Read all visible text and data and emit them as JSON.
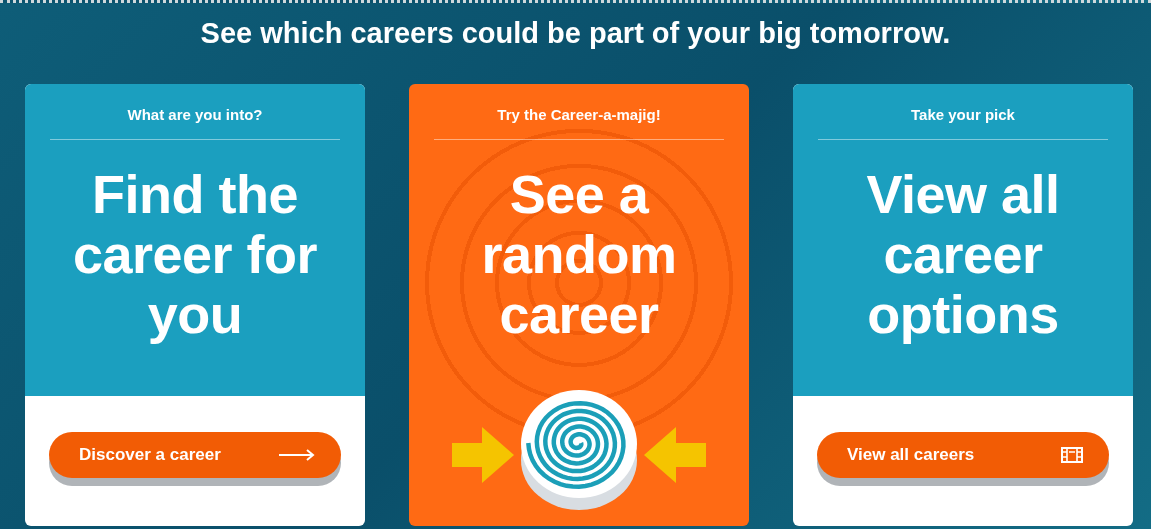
{
  "heading": "See which careers could be part of your big tomorrow.",
  "cards": [
    {
      "kind": "link",
      "eyebrow": "What are you into?",
      "headline": "Find the\ncareer for\nyou",
      "button": {
        "label": "Discover a career",
        "kind": "arrow"
      }
    },
    {
      "kind": "spinner",
      "eyebrow": "Try the Career-a-majig!",
      "headline": "See a\nrandom\ncareer"
    },
    {
      "kind": "link",
      "eyebrow": "Take your pick",
      "headline": "View all\ncareer\noptions",
      "button": {
        "label": "View all careers",
        "kind": "film"
      }
    }
  ]
}
